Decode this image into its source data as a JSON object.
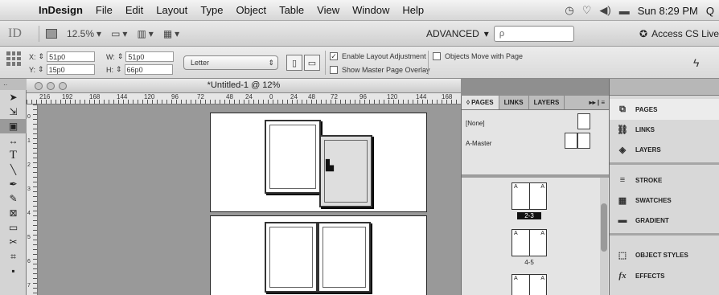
{
  "menubar": {
    "app_name": "InDesign",
    "items": [
      "File",
      "Edit",
      "Layout",
      "Type",
      "Object",
      "Table",
      "View",
      "Window",
      "Help"
    ],
    "clock": "Sun 8:29 PM",
    "search_glyph": "Q"
  },
  "appbar": {
    "logo": "ID",
    "zoom": "12.5%",
    "workspace": "ADVANCED",
    "search_placeholder": "ρ",
    "access": "Access CS Live"
  },
  "control": {
    "x_label": "X:",
    "x_value": "51p0",
    "y_label": "Y:",
    "y_value": "15p0",
    "w_label": "W:",
    "w_value": "51p0",
    "h_label": "H:",
    "h_value": "66p0",
    "preset": "Letter",
    "enable_layout_adjustment": "Enable Layout Adjustment",
    "enable_layout_checked": true,
    "show_master_overlay": "Show Master Page Overlay",
    "objects_move": "Objects Move with Page"
  },
  "document": {
    "title": "*Untitled-1 @ 12%",
    "ruler_labels": [
      "216",
      "192",
      "168",
      "144",
      "120",
      "96",
      "72",
      "48",
      "24",
      "0",
      "24",
      "48",
      "72",
      "96",
      "120",
      "144",
      "168"
    ],
    "vruler_labels": [
      "0",
      "1",
      "2",
      "3",
      "4",
      "5",
      "6",
      "7"
    ]
  },
  "pages_panel": {
    "tabs": [
      "◊ PAGES",
      "LINKS",
      "LAYERS"
    ],
    "menu": "▸▸ | ≡",
    "masters": [
      "[None]",
      "A-Master"
    ],
    "master_letter": "A",
    "spreads": [
      "2-3",
      "4-5"
    ]
  },
  "dock": {
    "items": [
      "PAGES",
      "LINKS",
      "LAYERS",
      "STROKE",
      "SWATCHES",
      "GRADIENT",
      "OBJECT STYLES",
      "EFFECTS"
    ]
  }
}
